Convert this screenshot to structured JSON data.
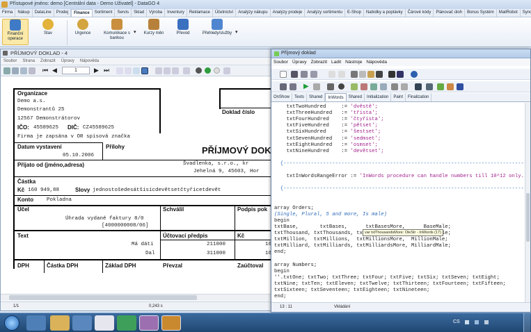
{
  "app": {
    "title": "Přístupové jméno: demo [Centrální data - Demo Uživatel] - DataGO 4"
  },
  "menu_tabs": [
    "Firma",
    "Nákup",
    "DataLine",
    "Prodej",
    "Finance",
    "Sortiment",
    "Servis",
    "Sklad",
    "Výroba",
    "Inventury",
    "Reklamace",
    "Účetnictví",
    "Analýzy nákupu",
    "Analýzy prodeje",
    "Analýzy sortimentu",
    "E-Shop",
    "Nabídky a poptávky",
    "Čárové kódy",
    "Plánovač úloh",
    "Bonus Systém",
    "MailRobot",
    "Synchronizace",
    "Ostatní"
  ],
  "active_tab": "Finance",
  "ribbon": {
    "financni": "Finanční operace",
    "stav": "Stav",
    "urgence": "Urgence",
    "komunikace": "Komunikace s bankou",
    "kurzy": "Kurzy měn",
    "prevod": "Převod",
    "prehledy": "Přehledy/služby"
  },
  "left_window": {
    "title": "PŘÍJMOVÝ DOKLAD - 4",
    "menu": [
      "Soubor",
      "Strana",
      "Zobrazit",
      "Úpravy",
      "Nápověda"
    ],
    "page_input": "1",
    "doc": {
      "organizace_label": "Organizace",
      "org_name": "Demo a.s.",
      "org_street": "Demonstrantů 25",
      "org_city": "12567 Demonstrátorov",
      "ico_label": "IČO:",
      "ico": "45589625",
      "dic_label": "DIČ:",
      "dic": "CZ45589625",
      "firma_note": "Firma je zapsána v OR spisová značka",
      "datum_label": "Datum vystavení",
      "datum": "05.10.2006",
      "prilohy_label": "Přílohy",
      "doklad_cislo_label": "Doklad číslo",
      "doc_title": "PŘÍJMOVÝ DOK",
      "prijato_label": "Přijato od (jméno,adresa)",
      "prijato_line1": "Švadlenka, s.r.o., kr",
      "prijato_line2": "Jehelná 9, 45603, Hor",
      "castka_label": "Částka",
      "kc_label": "Kč",
      "castka": "160 949,88",
      "slovy_label": "Slovy",
      "slovy": "jednostošedesátšisícdevětsetčtyřicetdevět",
      "konto_label": "Konto",
      "konto": "Pokladna",
      "ucel_label": "Účel",
      "schvalil_label": "Schválil",
      "podpis_label": "Podpis pok",
      "ucel_text1": "Úhrada vydané faktury 8/0",
      "ucel_text2": "[4000000008/06]",
      "text_label": "Text",
      "predpis_label": "Účtovací předpis",
      "kc2_label": "Kč",
      "row1_text": "Má dáti",
      "row1_num": "211000",
      "row1_kc": "16",
      "row2_text": "Dal",
      "row2_num": "311000",
      "row2_kc": "16",
      "dph_label": "DPH",
      "castka_dph_label": "Částka DPH",
      "zaklad_dph_label": "Základ DPH",
      "prevzal_label": "Převzal",
      "zauctoval_label": "Zaúčtoval"
    },
    "status": {
      "page": "1/1",
      "time": "0,243 s"
    }
  },
  "right_window": {
    "title": "Příjmový doklad",
    "menu": [
      "Soubor",
      "Úpravy",
      "Zobrazit",
      "Ladit",
      "Nástroje",
      "Nápověda"
    ],
    "tabs": [
      "OnShow",
      "Texts",
      "Shared",
      "InWords",
      "Shared",
      "Initialization",
      "Paint",
      "Finalization"
    ],
    "active_tab": "InWords",
    "code": [
      {
        "t": "    txtTwoHundred     := ",
        "s": "'dvěstě';"
      },
      {
        "t": "    txtThreeHundred   := ",
        "s": "'třista';"
      },
      {
        "t": "    txtFourHundred    := ",
        "s": "'čtyřista';"
      },
      {
        "t": "    txtFiveHundred    := ",
        "s": "'pětset';"
      },
      {
        "t": "    txtSixHundred     := ",
        "s": "'šestset';"
      },
      {
        "t": "    txtSevenHundred   := ",
        "s": "'sedmset';"
      },
      {
        "t": "    txtEightHundred   := ",
        "s": "'osmset';"
      },
      {
        "t": "    txtNineHundred    := ",
        "s": "'devětset';"
      },
      {
        "t": "",
        "s": ""
      },
      {
        "c": "  {----------------------------------------------------------------------------------}"
      },
      {
        "t": "",
        "s": ""
      },
      {
        "t": "    txtInWordsRangeError := ",
        "s": "'InWords procedure can handle numbers till 10^12 only.'"
      },
      {
        "t": "",
        "s": ""
      },
      {
        "c": "  {----------------------------------------------------------------------------------}"
      },
      {
        "t": "",
        "s": ""
      },
      {
        "t": "",
        "s": ""
      },
      {
        "t": "array Orders;",
        "s": ""
      },
      {
        "ci": "(Single, Plural, 5 and more, Is male)"
      },
      {
        "t": "begin",
        "s": ""
      },
      {
        "t": "txtBase,       txtBases,      txtBasesMore,      BaseMale;",
        "s": ""
      },
      {
        "t": "txtThousand, txtThousands, txtThousandsMore, ThousandMale;",
        "s": ""
      },
      {
        "t": "txtMillion,  txtMillions,  txtMillionsMore,  MillionMale;",
        "s": ""
      },
      {
        "t": "txtMilliard, txtMilliards, txtMilliardsMore, MilliardMale;",
        "s": ""
      },
      {
        "t": "end;",
        "s": ""
      },
      {
        "t": "",
        "s": ""
      },
      {
        "t": "array Numbers;",
        "s": ""
      },
      {
        "t": "begin",
        "s": ""
      },
      {
        "t": "''.txtOne; txtTwo; txtThree; txtFour; txtFive; txtSix; txtSeven; txtEight;",
        "s": ""
      },
      {
        "t": "txtNine; txtTen; txtEleven; txtTwelve; txtThirteen; txtFourteen; txtFifteen;",
        "s": ""
      },
      {
        "t": "txtSixteen; txtSeventeen; txtEighteen; txtNineteen;",
        "s": ""
      },
      {
        "t": "end;",
        "s": ""
      }
    ],
    "tooltip": "var txtThousandsMore: OleStr - InWords (17)",
    "status": {
      "pos": "13 : 11",
      "mode": "Vkládání"
    }
  },
  "taskbar": {
    "lang": "CS"
  }
}
